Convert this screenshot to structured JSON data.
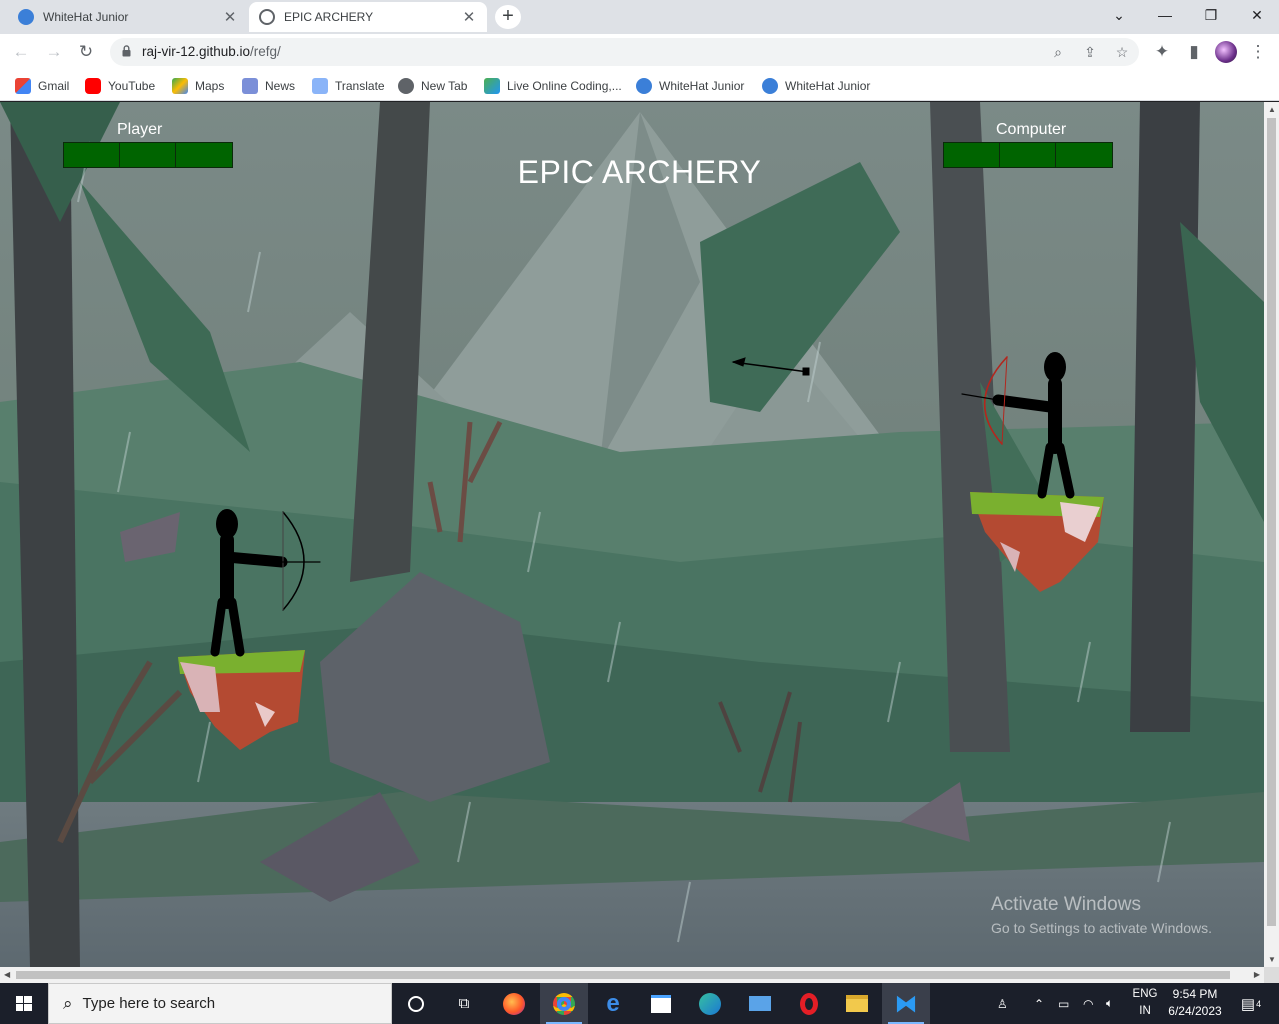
{
  "browser": {
    "tabs": [
      {
        "title": "WhiteHat Junior",
        "active": false
      },
      {
        "title": "EPIC ARCHERY",
        "active": true
      }
    ],
    "url_domain": "raj-vir-12.github.io",
    "url_path": "/refg/",
    "bookmarks": [
      {
        "label": "Gmail"
      },
      {
        "label": "YouTube"
      },
      {
        "label": "Maps"
      },
      {
        "label": "News"
      },
      {
        "label": "Translate"
      },
      {
        "label": "New Tab"
      },
      {
        "label": "Live Online Coding,..."
      },
      {
        "label": "WhiteHat Junior"
      },
      {
        "label": "WhiteHat Junior"
      }
    ]
  },
  "game": {
    "title": "EPIC ARCHERY",
    "player": {
      "label": "Player",
      "health_segments": 3,
      "health_max": 3
    },
    "computer": {
      "label": "Computer",
      "health_segments": 3,
      "health_max": 3
    }
  },
  "watermark": {
    "line1": "Activate Windows",
    "line2": "Go to Settings to activate Windows."
  },
  "taskbar": {
    "search_placeholder": "Type here to search",
    "lang": "ENG",
    "region": "IN",
    "time": "9:54 PM",
    "date": "6/24/2023",
    "notification_count": "4"
  },
  "colors": {
    "health": "#006400",
    "sky": "#6f7f7d",
    "ground": "#3f6756"
  }
}
